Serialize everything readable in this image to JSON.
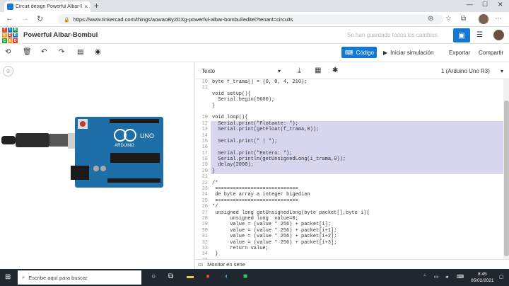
{
  "browser": {
    "tab_title": "Circuit design Powerful Albar-Bo",
    "tab_close": "×",
    "new_tab": "+",
    "url_prefix": "https://",
    "url": "www.tinkercad.com/things/aowaoBy2DXg-powerful-albar-bombul/editel?tenant=circuits"
  },
  "app": {
    "logo_letters": [
      "TIN",
      "KER",
      "CAD"
    ],
    "project_title": "Powerful Albar-Bombul",
    "save_status": "Se han guardado todos los cambios."
  },
  "toolbar": {
    "code_label": "Código",
    "simulate_label": "Iniciar simulación",
    "export_label": "Exportar",
    "share_label": "Compartir"
  },
  "code_panel": {
    "mode": "Texto",
    "device": "1 (Arduino Uno R3)",
    "lines": [
      {
        "n": "10",
        "t": "byte f_trama[] = {0, 0, 4, 210};"
      },
      {
        "n": "11",
        "t": ""
      },
      {
        "n": "",
        "t": "void setup(){"
      },
      {
        "n": "",
        "t": "  Serial.begin(9600);"
      },
      {
        "n": "",
        "t": "}"
      },
      {
        "n": "",
        "t": ""
      },
      {
        "n": "10",
        "t": "void loop(){"
      },
      {
        "n": "12",
        "t": "  Serial.print(\"Flotante: \");"
      },
      {
        "n": "13",
        "t": "  Serial.print(getFloat(f_trama,0));"
      },
      {
        "n": "14",
        "t": ""
      },
      {
        "n": "15",
        "t": "  Serial.print(\" | \");"
      },
      {
        "n": "16",
        "t": ""
      },
      {
        "n": "17",
        "t": "  Serial.print(\"Entero: \");"
      },
      {
        "n": "18",
        "t": "  Serial.println(getUnsignedLong(i_trama,0));"
      },
      {
        "n": "19",
        "t": "  delay(2000);"
      },
      {
        "n": "20",
        "t": "}"
      },
      {
        "n": "21",
        "t": ""
      },
      {
        "n": "22",
        "t": "/*"
      },
      {
        "n": "23",
        "t": " ============================"
      },
      {
        "n": "24",
        "t": " de byte array a integer bigedian"
      },
      {
        "n": "25",
        "t": " ============================"
      },
      {
        "n": "26",
        "t": "*/"
      },
      {
        "n": "27",
        "t": " unsigned long getUnsignedLong(byte packet[],byte i){"
      },
      {
        "n": "28",
        "t": "      unsigned long  value=0;"
      },
      {
        "n": "29",
        "t": "      value = (value * 256) + packet[i];"
      },
      {
        "n": "30",
        "t": "      value = (value * 256) + packet[i+1];"
      },
      {
        "n": "31",
        "t": "      value = (value * 256) + packet[i+2];"
      },
      {
        "n": "32",
        "t": "      value = (value * 256) + packet[i+3];"
      },
      {
        "n": "33",
        "t": "      return value;"
      },
      {
        "n": "34",
        "t": " }"
      },
      {
        "n": "35",
        "t": ""
      }
    ],
    "highlighted_lines": [
      7,
      8,
      9,
      10,
      11,
      12,
      13,
      14,
      15
    ]
  },
  "serial_monitor": {
    "label": "Monitor en serie"
  },
  "taskbar": {
    "search_placeholder": "Escribe aquí para buscar",
    "time": "8:45",
    "date": "05/02/2021"
  },
  "board": {
    "brand": "ARDUINO",
    "model": "UNO"
  },
  "colors": {
    "accent": "#1477d1",
    "board": "#1e6fa8",
    "highlight": "#d8d6ee",
    "taskbar": "#20272e"
  }
}
